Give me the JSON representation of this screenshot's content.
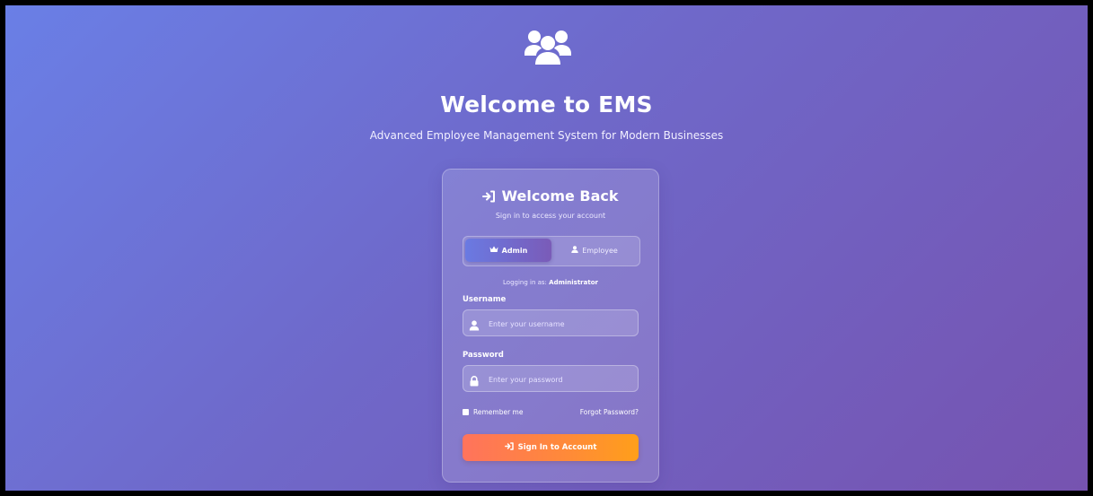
{
  "header": {
    "logo_icon": "users-icon",
    "title": "Welcome to EMS",
    "subtitle": "Advanced Employee Management System for Modern Businesses"
  },
  "card": {
    "title_icon": "sign-in-icon",
    "title": "Welcome Back",
    "subtitle": "Sign in to access your account",
    "roles": {
      "admin_icon": "crown-icon",
      "admin_label": "Admin",
      "employee_icon": "user-icon",
      "employee_label": "Employee",
      "selected": "Admin"
    },
    "logging_as_prefix": "Logging in as:",
    "logging_as_role": "Administrator",
    "username": {
      "label": "Username",
      "icon": "user-icon",
      "placeholder": "Enter your username",
      "value": ""
    },
    "password": {
      "label": "Password",
      "icon": "lock-icon",
      "placeholder": "Enter your password",
      "value": ""
    },
    "remember_label": "Remember me",
    "forgot_label": "Forgot Password?",
    "submit_icon": "sign-in-icon",
    "submit_label": "Sign In to Account"
  },
  "colors": {
    "bg_start": "#6a7fe6",
    "bg_end": "#7653b0",
    "accent_orange": "#ff8a38",
    "admin_tab": "#6a7ae2"
  }
}
